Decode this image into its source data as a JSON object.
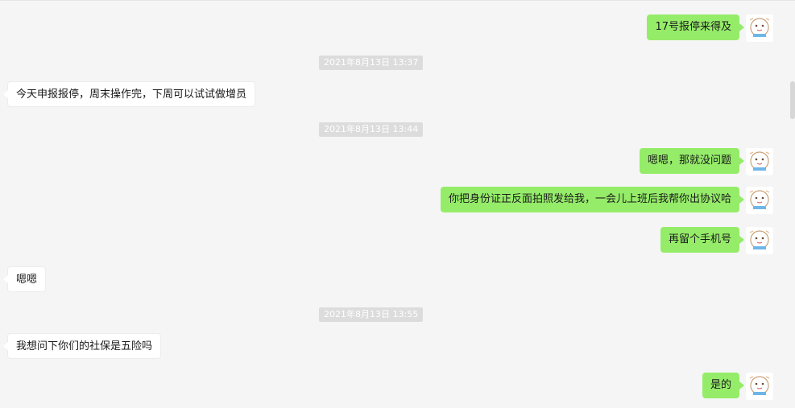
{
  "messages": {
    "m1": "17号报停来得及",
    "t1": "2021年8月13日 13:37",
    "m2": "今天申报报停，周末操作完，下周可以试试做增员",
    "t2": "2021年8月13日 13:44",
    "m3": "嗯嗯，那就没问题",
    "m4": "你把身份证正反面拍照发给我，一会儿上班后我帮你出协议哈",
    "m5": "再留个手机号",
    "m6": "嗯嗯",
    "t3": "2021年8月13日 13:55",
    "m7": "我想问下你们的社保是五险吗",
    "m8": "是的"
  },
  "avatar_icon": "cartoon-avatar-icon",
  "colors": {
    "background": "#f5f5f5",
    "outgoing_bubble": "#95ec69",
    "incoming_bubble": "#ffffff",
    "timestamp_bg": "#dcdcdc"
  }
}
